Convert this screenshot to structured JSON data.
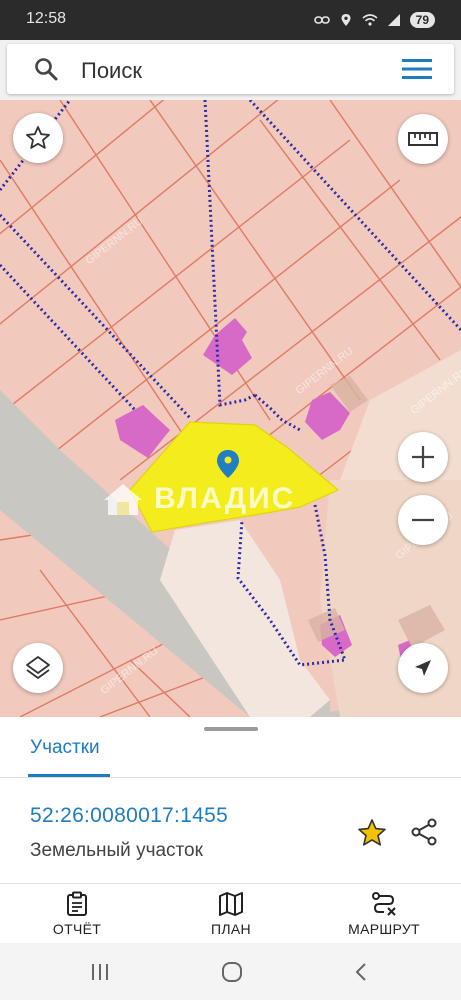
{
  "status_bar": {
    "time": "12:58",
    "battery": "79",
    "icons": [
      "link-icon",
      "location-icon",
      "wifi-icon",
      "signal-icon",
      "battery-icon"
    ]
  },
  "search": {
    "placeholder": "Поиск",
    "icon": "search-icon",
    "menu_icon": "menu-icon"
  },
  "map": {
    "controls": {
      "favorite_icon": "star-icon",
      "ruler_icon": "ruler-icon",
      "zoom_in_icon": "plus-icon",
      "zoom_out_icon": "minus-icon",
      "layers_icon": "layers-icon",
      "locate_icon": "navigation-arrow-icon"
    },
    "watermark": "ВЛАДИС",
    "copyright_marks": [
      "GIPERNN.RU",
      "GIPERNN.RU",
      "GIPERNN.RU",
      "GIPERNN.RU",
      "GIPERNN.RU"
    ],
    "colors": {
      "background": "#f1c9bd",
      "parcel_lines": "#e07a62",
      "selected_parcel": "#f4ec1c",
      "buildings": "#d769c7",
      "road": "#c9c7c2",
      "boundary_dots": "#2c2ca8",
      "marker": "#1f7fc0"
    }
  },
  "sheet": {
    "tab_label": "Участки",
    "parcel_number": "52:26:0080017:1455",
    "parcel_type": "Земельный участок",
    "star_color": "#f2c200",
    "actions": [
      {
        "label": "ОТЧЁТ",
        "icon": "clipboard-icon"
      },
      {
        "label": "ПЛАН",
        "icon": "map-icon"
      },
      {
        "label": "МАРШРУТ",
        "icon": "route-icon"
      }
    ]
  },
  "nav_bar": {
    "icons": [
      "recent-apps-icon",
      "home-icon",
      "back-icon"
    ]
  }
}
